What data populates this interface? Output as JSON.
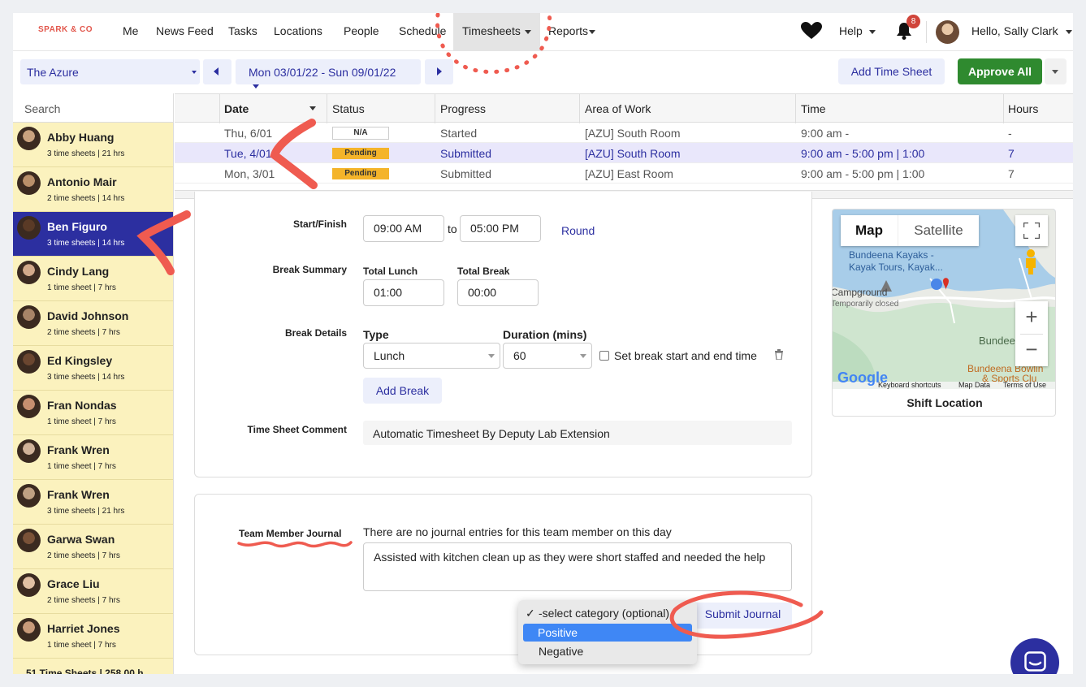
{
  "nav": {
    "brand": "SPARK & CO",
    "items": [
      "Me",
      "News Feed",
      "Tasks",
      "Locations",
      "People",
      "Schedule",
      "Timesheets",
      "Reports"
    ],
    "help": "Help",
    "notifications": "8",
    "greeting": "Hello, Sally Clark"
  },
  "toolbar": {
    "location": "The Azure",
    "date_range": "Mon 03/01/22 - Sun 09/01/22",
    "add_time_sheet": "Add Time Sheet",
    "approve_all": "Approve All"
  },
  "sidebar": {
    "search_placeholder": "Search",
    "people": [
      {
        "name": "Abby Huang",
        "meta": "3 time sheets | 21 hrs"
      },
      {
        "name": "Antonio Mair",
        "meta": "2 time sheets | 14 hrs"
      },
      {
        "name": "Ben Figuro",
        "meta": "3 time sheets | 14 hrs"
      },
      {
        "name": "Cindy Lang",
        "meta": "1 time sheet | 7 hrs"
      },
      {
        "name": "David Johnson",
        "meta": "2 time sheets | 7 hrs"
      },
      {
        "name": "Ed Kingsley",
        "meta": "3 time sheets | 14 hrs"
      },
      {
        "name": "Fran Nondas",
        "meta": "1 time sheet | 7 hrs"
      },
      {
        "name": "Frank Wren",
        "meta": "1 time sheet | 7 hrs"
      },
      {
        "name": "Frank Wren",
        "meta": "3 time sheets | 21 hrs"
      },
      {
        "name": "Garwa Swan",
        "meta": "2 time sheets | 7 hrs"
      },
      {
        "name": "Grace Liu",
        "meta": "2 time sheets | 7 hrs"
      },
      {
        "name": "Harriet Jones",
        "meta": "1 time sheet | 7 hrs"
      }
    ]
  },
  "grid": {
    "headers": [
      "Date",
      "Status",
      "Progress",
      "Area of Work",
      "Time",
      "Hours"
    ],
    "rows": [
      {
        "date": "Thu, 6/01",
        "status": "N/A",
        "progress": "Started",
        "area": "[AZU] South Room",
        "time": "9:00 am -",
        "hours": "-"
      },
      {
        "date": "Tue, 4/01",
        "status": "Pending",
        "progress": "Submitted",
        "area": "[AZU] South Room",
        "time": "9:00 am - 5:00 pm | 1:00",
        "hours": "7"
      },
      {
        "date": "Mon, 3/01",
        "status": "Pending",
        "progress": "Submitted",
        "area": "[AZU] East Room",
        "time": "9:00 am - 5:00 pm | 1:00",
        "hours": "7"
      }
    ]
  },
  "detail": {
    "start_finish_label": "Start/Finish",
    "start": "09:00 AM",
    "to": "to",
    "finish": "05:00 PM",
    "round": "Round",
    "break_summary_label": "Break Summary",
    "total_lunch_label": "Total Lunch",
    "total_lunch": "01:00",
    "total_break_label": "Total Break",
    "total_break": "00:00",
    "break_details_label": "Break Details",
    "type_label": "Type",
    "type_value": "Lunch",
    "duration_label": "Duration (mins)",
    "duration_value": "60",
    "set_break_label": "Set break start and end time",
    "add_break": "Add Break",
    "comment_label": "Time Sheet Comment",
    "comment": "Automatic Timesheet By Deputy Lab Extension"
  },
  "map": {
    "tab_map": "Map",
    "tab_satellite": "Satellite",
    "place1": "Bundeena Kayaks -",
    "place2": "Kayak Tours, Kayak...",
    "place3": "Campground",
    "place4": "Temporarily closed",
    "place5": "Bundeena",
    "place6": "Bundeena Bowlin",
    "place7": "& Sports Clu",
    "google": "Google",
    "shortcuts": "Keyboard shortcuts",
    "mapdata": "Map Data",
    "terms": "Terms of Use",
    "footer": "Shift Location"
  },
  "journal": {
    "label": "Team Member Journal",
    "empty": "There are no journal entries for this team member on this day",
    "text": "Assisted with kitchen clean up as they were short staffed and needed the help",
    "submit": "Submit Journal",
    "options": [
      "-select category (optional)",
      "Positive",
      "Negative"
    ],
    "selected_check": "✓"
  },
  "footer_partial": "51 Time Sheets | 258.00 h",
  "colors": {
    "accent": "#2c2fa0",
    "pending": "#f4b42a",
    "approve": "#2f8a2f",
    "annotation": "#ef5b50"
  }
}
